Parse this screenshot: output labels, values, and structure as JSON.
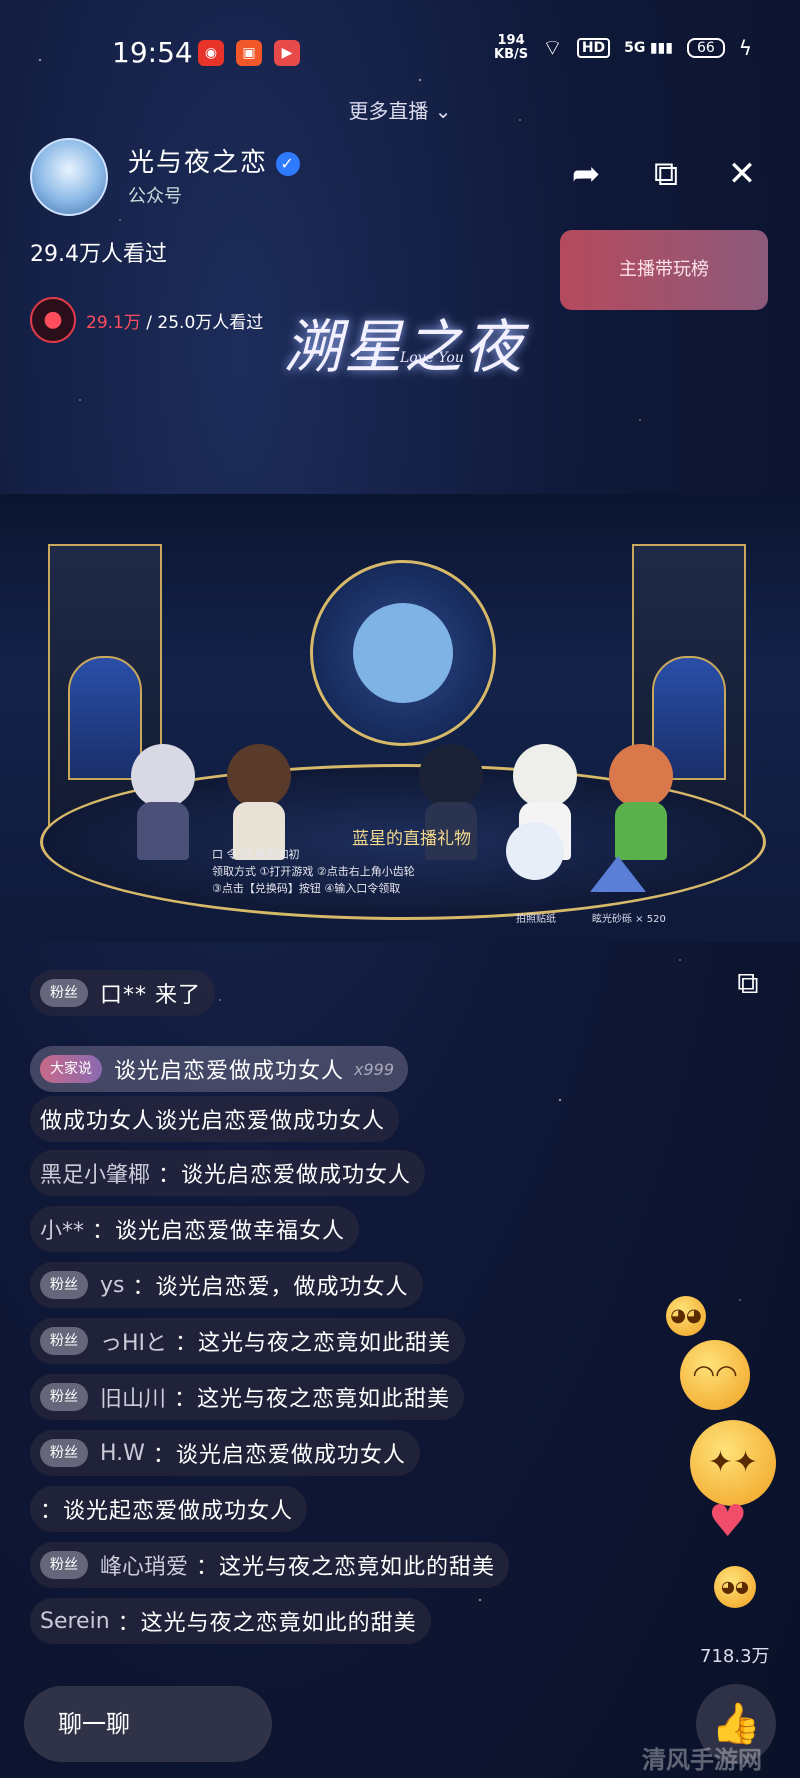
{
  "status_bar": {
    "time": "19:54",
    "speed": "194",
    "speed_unit": "KB/S",
    "hd": "HD",
    "network": "5G",
    "battery": "66"
  },
  "top": {
    "more_live": "更多直播 ⌄"
  },
  "header": {
    "streamer_name": "光与夜之恋",
    "subtitle": "公众号",
    "share_icon": "share-icon",
    "pip_icon": "pip-icon",
    "close_icon": "close-icon"
  },
  "views": {
    "total": "29.4万人看过",
    "rank_button": "主播带玩榜"
  },
  "fans": {
    "value": "29.1万",
    "separator": " / ",
    "total": "25.0万人看过"
  },
  "logo": {
    "title": "溯星之夜",
    "subtitle": "Love You"
  },
  "video": {
    "gift_title": "蓝星的直播礼物",
    "gift_lines": [
      "口 令 码   唯爱如初",
      "领取方式 ①打开游戏 ②点击右上角小齿轮",
      "③点击【兑换码】按钮 ④输入口令领取"
    ],
    "sticker_label": "拍照贴纸",
    "sand_label": "眩光砂砾 × 520"
  },
  "chat": [
    {
      "badge": "粉丝",
      "user": "",
      "text": "口** 来了"
    },
    {
      "badge": "大家说",
      "user": "",
      "text": "谈光启恋爱做成功女人",
      "extra": "x999"
    },
    {
      "badge": "",
      "user": "",
      "text": "做成功女人谈光启恋爱做成功女人"
    },
    {
      "badge": "",
      "user": "黑足小肇椰",
      "text": "：谈光启恋爱做成功女人"
    },
    {
      "badge": "",
      "user": "小**",
      "text": "：谈光启恋爱做幸福女人"
    },
    {
      "badge": "粉丝",
      "user": "ys",
      "text": "：谈光启恋爱，做成功女人"
    },
    {
      "badge": "粉丝",
      "user": "っHIと",
      "text": "：这光与夜之恋竟如此甜美"
    },
    {
      "badge": "粉丝",
      "user": "旧山川",
      "text": "：这光与夜之恋竟如此甜美"
    },
    {
      "badge": "粉丝",
      "user": "H.W",
      "text": "：谈光启恋爱做成功女人"
    },
    {
      "badge": "",
      "user": "",
      "text": "：谈光起恋爱做成功女人"
    },
    {
      "badge": "粉丝",
      "user": "峰心琑爱",
      "text": "：这光与夜之恋竟如此的甜美"
    },
    {
      "badge": "",
      "user": "Serein",
      "text": "：这光与夜之恋竟如此的甜美"
    }
  ],
  "likes": {
    "count": "718.3万"
  },
  "bottom": {
    "chat_placeholder": "聊一聊"
  },
  "watermark": "清风手游网"
}
